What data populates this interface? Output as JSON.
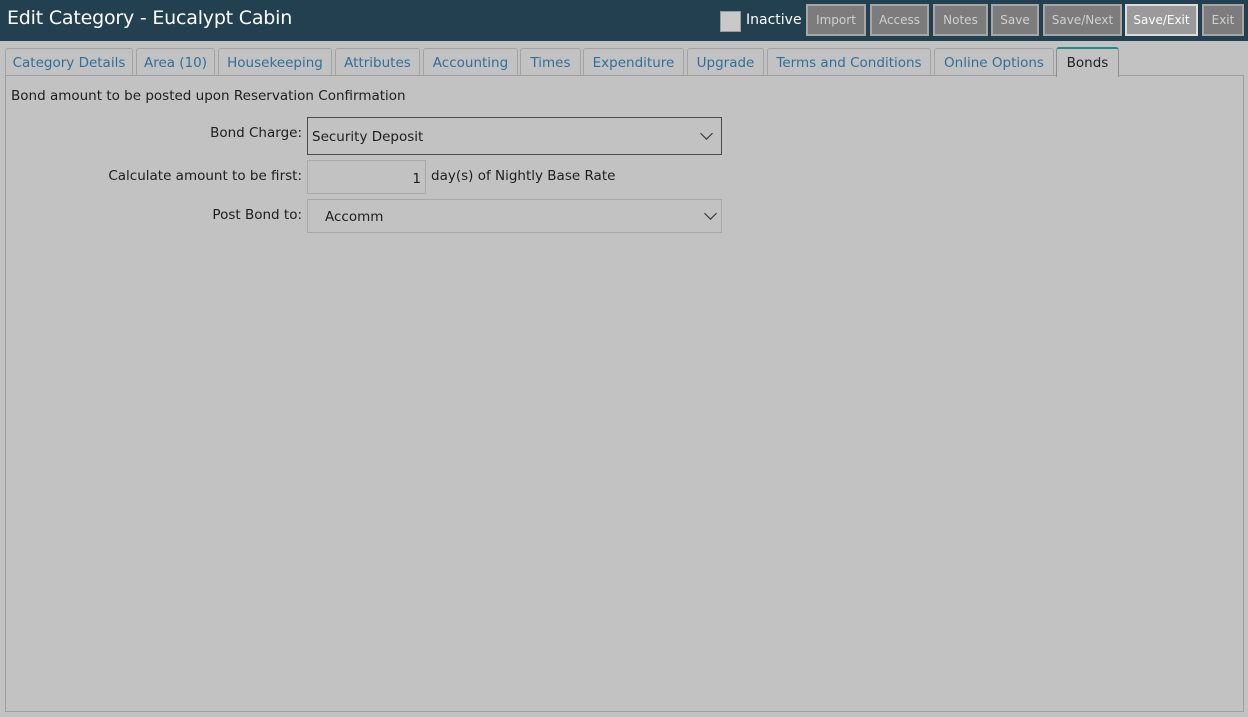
{
  "window": {
    "title": "Edit Category - Eucalypt Cabin"
  },
  "header": {
    "inactive_label": "Inactive",
    "inactive_checked": false,
    "buttons": [
      "Import",
      "Access",
      "Notes",
      "Save",
      "Save/Next",
      "Save/Exit",
      "Exit"
    ]
  },
  "tabs": [
    "Category Details",
    "Area (10)",
    "Housekeeping",
    "Attributes",
    "Accounting",
    "Times",
    "Expenditure",
    "Upgrade",
    "Terms and Conditions",
    "Online Options",
    "Bonds"
  ],
  "active_tab": "Bonds",
  "bonds": {
    "heading": "Bond amount to be posted upon Reservation Confirmation",
    "bond_charge_label": "Bond Charge:",
    "bond_charge_value": "Security Deposit",
    "calc_label": "Calculate amount to be first:",
    "calc_value": "1",
    "calc_suffix": "day(s) of Nightly Base Rate",
    "post_label": "Post Bond to:",
    "post_value": "Accomm"
  },
  "colors": {
    "titlebar": "#224050",
    "background": "#c2c2c2",
    "tab_text": "#2f6f9e",
    "active_tab_accent": "#1c8c8c"
  }
}
